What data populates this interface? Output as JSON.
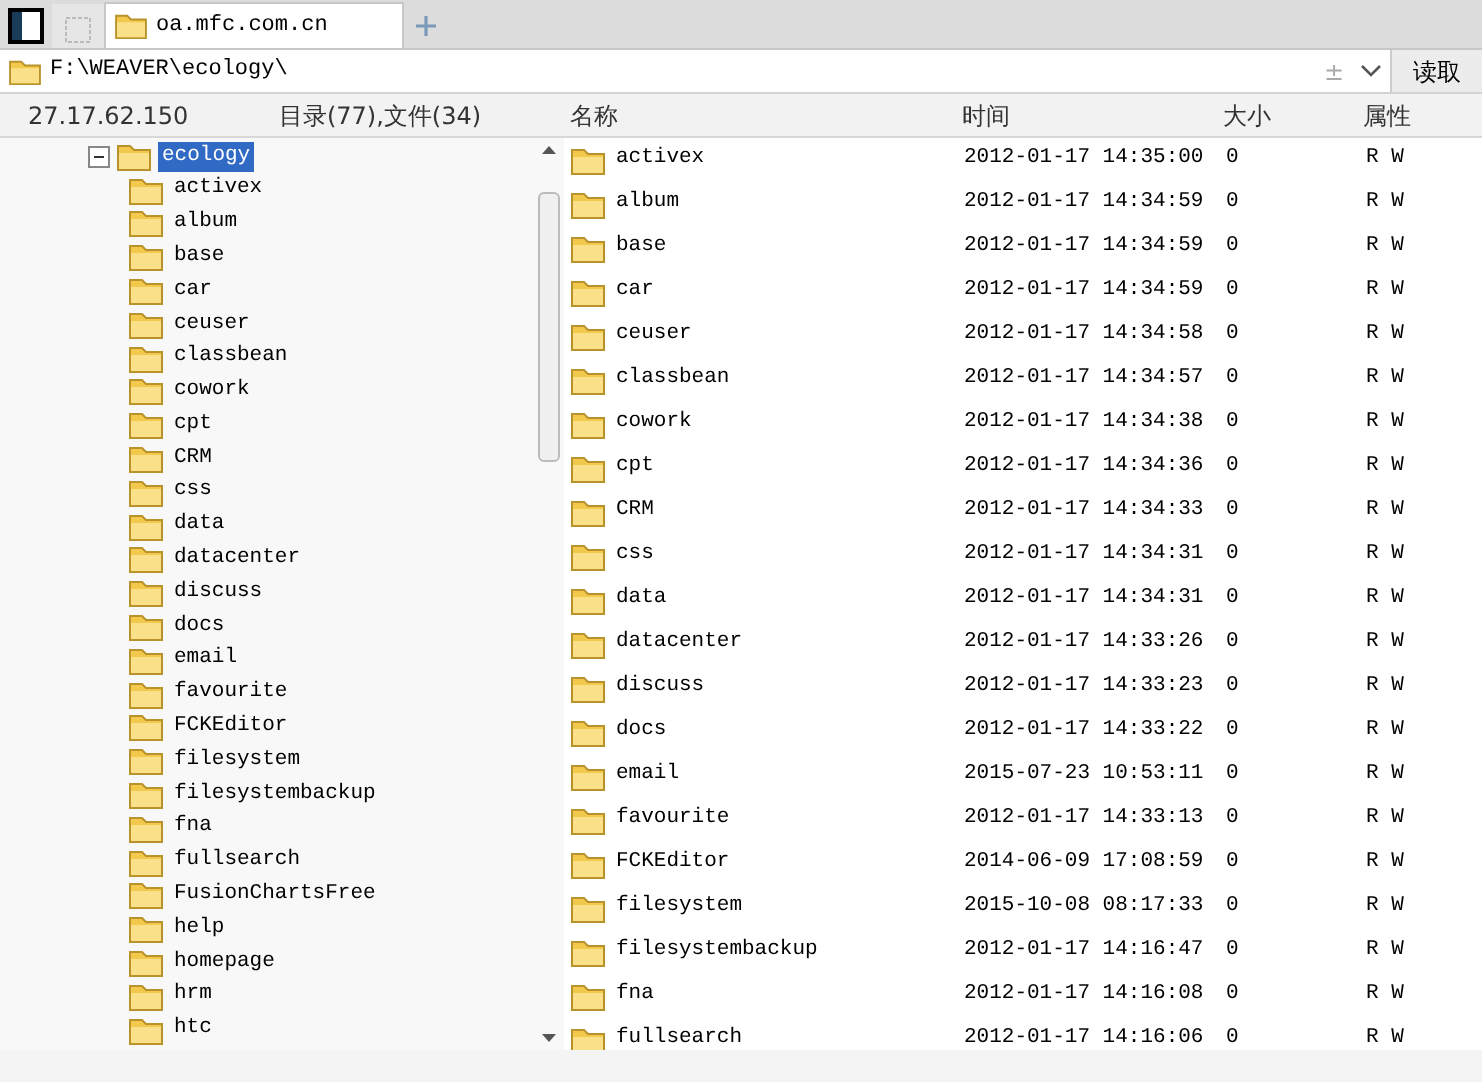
{
  "tabs": [
    {
      "label": "oa.mfc.com.cn",
      "selected": true
    }
  ],
  "address": {
    "path": "F:\\WEAVER\\ecology\\",
    "toggle": "±",
    "read_button": "读取"
  },
  "info": {
    "host": "27.17.62.150",
    "counts": "目录(77),文件(34)"
  },
  "columns": [
    "名称",
    "时间",
    "大小",
    "属性"
  ],
  "tree": {
    "label": "ecology",
    "expanded": true,
    "selected": true,
    "children": [
      {
        "label": "activex",
        "selected": false
      },
      {
        "label": "album",
        "selected": false
      },
      {
        "label": "base",
        "selected": false
      },
      {
        "label": "car",
        "selected": false
      },
      {
        "label": "ceuser",
        "selected": false
      },
      {
        "label": "classbean",
        "selected": false
      },
      {
        "label": "cowork",
        "selected": false
      },
      {
        "label": "cpt",
        "selected": false
      },
      {
        "label": "CRM",
        "selected": false
      },
      {
        "label": "css",
        "selected": false
      },
      {
        "label": "data",
        "selected": false
      },
      {
        "label": "datacenter",
        "selected": false
      },
      {
        "label": "discuss",
        "selected": false
      },
      {
        "label": "docs",
        "selected": false
      },
      {
        "label": "email",
        "selected": false
      },
      {
        "label": "favourite",
        "selected": false
      },
      {
        "label": "FCKEditor",
        "selected": false
      },
      {
        "label": "filesystem",
        "selected": false
      },
      {
        "label": "filesystembackup",
        "selected": false
      },
      {
        "label": "fna",
        "selected": false
      },
      {
        "label": "fullsearch",
        "selected": false
      },
      {
        "label": "FusionChartsFree",
        "selected": false
      },
      {
        "label": "help",
        "selected": false
      },
      {
        "label": "homepage",
        "selected": false
      },
      {
        "label": "hrm",
        "selected": false
      },
      {
        "label": "htc",
        "selected": false
      }
    ]
  },
  "files": [
    {
      "name": "activex",
      "time": "2012-01-17 14:35:00",
      "size": "0",
      "attr": "R W"
    },
    {
      "name": "album",
      "time": "2012-01-17 14:34:59",
      "size": "0",
      "attr": "R W"
    },
    {
      "name": "base",
      "time": "2012-01-17 14:34:59",
      "size": "0",
      "attr": "R W"
    },
    {
      "name": "car",
      "time": "2012-01-17 14:34:59",
      "size": "0",
      "attr": "R W"
    },
    {
      "name": "ceuser",
      "time": "2012-01-17 14:34:58",
      "size": "0",
      "attr": "R W"
    },
    {
      "name": "classbean",
      "time": "2012-01-17 14:34:57",
      "size": "0",
      "attr": "R W"
    },
    {
      "name": "cowork",
      "time": "2012-01-17 14:34:38",
      "size": "0",
      "attr": "R W"
    },
    {
      "name": "cpt",
      "time": "2012-01-17 14:34:36",
      "size": "0",
      "attr": "R W"
    },
    {
      "name": "CRM",
      "time": "2012-01-17 14:34:33",
      "size": "0",
      "attr": "R W"
    },
    {
      "name": "css",
      "time": "2012-01-17 14:34:31",
      "size": "0",
      "attr": "R W"
    },
    {
      "name": "data",
      "time": "2012-01-17 14:34:31",
      "size": "0",
      "attr": "R W"
    },
    {
      "name": "datacenter",
      "time": "2012-01-17 14:33:26",
      "size": "0",
      "attr": "R W"
    },
    {
      "name": "discuss",
      "time": "2012-01-17 14:33:23",
      "size": "0",
      "attr": "R W"
    },
    {
      "name": "docs",
      "time": "2012-01-17 14:33:22",
      "size": "0",
      "attr": "R W"
    },
    {
      "name": "email",
      "time": "2015-07-23 10:53:11",
      "size": "0",
      "attr": "R W"
    },
    {
      "name": "favourite",
      "time": "2012-01-17 14:33:13",
      "size": "0",
      "attr": "R W"
    },
    {
      "name": "FCKEditor",
      "time": "2014-06-09 17:08:59",
      "size": "0",
      "attr": "R W"
    },
    {
      "name": "filesystem",
      "time": "2015-10-08 08:17:33",
      "size": "0",
      "attr": "R W"
    },
    {
      "name": "filesystembackup",
      "time": "2012-01-17 14:16:47",
      "size": "0",
      "attr": "R W"
    },
    {
      "name": "fna",
      "time": "2012-01-17 14:16:08",
      "size": "0",
      "attr": "R W"
    },
    {
      "name": "fullsearch",
      "time": "2012-01-17 14:16:06",
      "size": "0",
      "attr": "R W"
    }
  ]
}
